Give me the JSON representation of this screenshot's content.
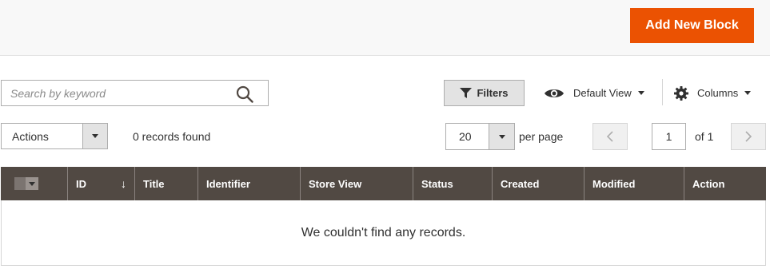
{
  "header": {
    "add_button_label": "Add New Block"
  },
  "search": {
    "placeholder": "Search by keyword",
    "value": ""
  },
  "toolbar": {
    "filters_label": "Filters",
    "view_label": "Default View",
    "columns_label": "Columns"
  },
  "actions": {
    "label": "Actions"
  },
  "records": {
    "count_text": "0 records found"
  },
  "pagination": {
    "per_page_value": "20",
    "per_page_label": "per page",
    "current_page": "1",
    "of_label": "of 1"
  },
  "grid": {
    "columns": [
      "ID",
      "Title",
      "Identifier",
      "Store View",
      "Status",
      "Created",
      "Modified",
      "Action"
    ],
    "sort_indicator": "↓",
    "empty_message": "We couldn't find any records."
  },
  "colors": {
    "accent": "#eb5202",
    "grid_header": "#514943"
  },
  "icons": [
    "search-icon",
    "filter-icon",
    "eye-icon",
    "gear-icon",
    "chevron-left-icon",
    "chevron-right-icon"
  ]
}
